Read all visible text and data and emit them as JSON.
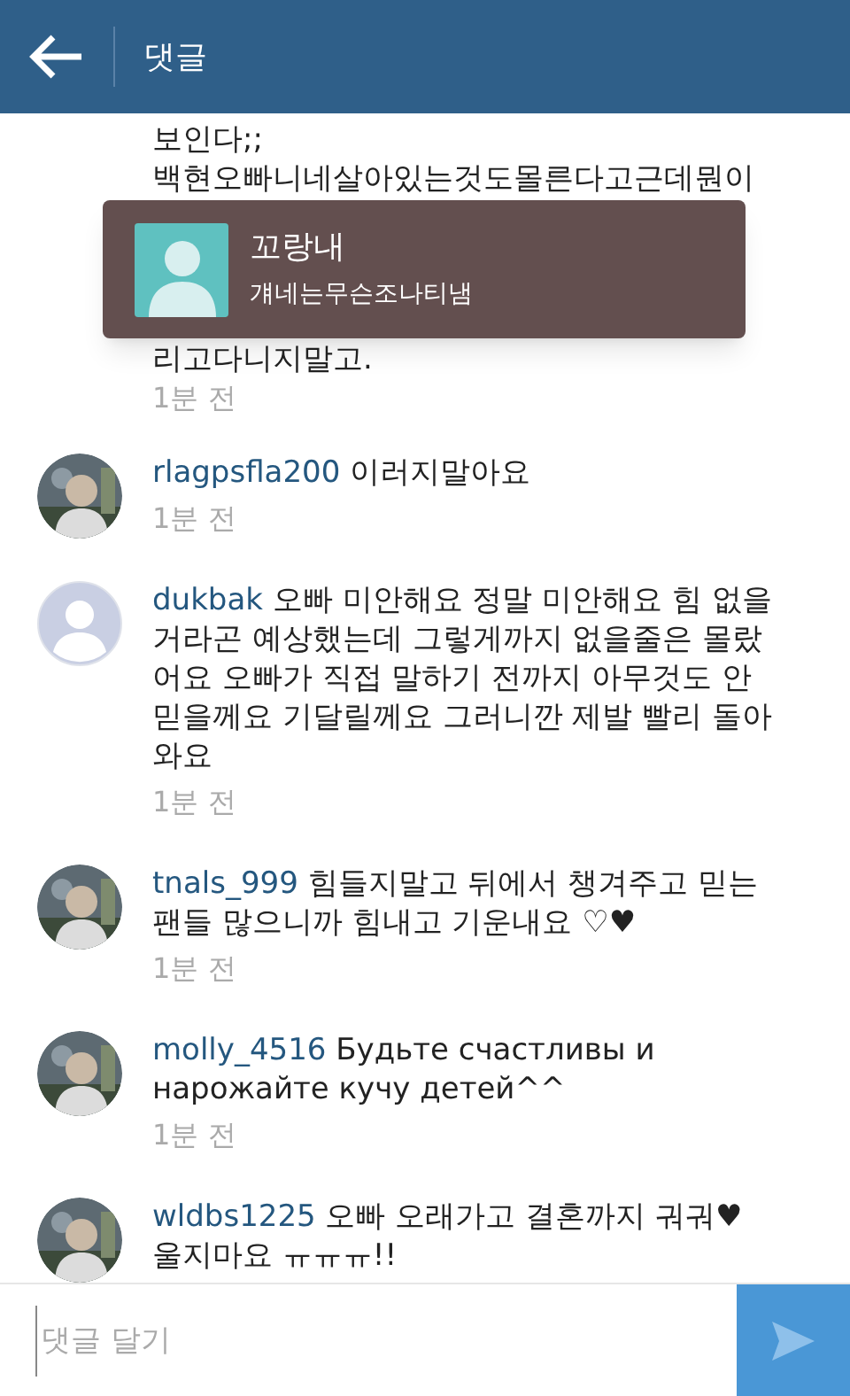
{
  "header": {
    "title": "댓글"
  },
  "comments": [
    {
      "kind": "partial",
      "lines": [
        "보인다;;",
        "백현오빠니네살아있는것도몰른다고근데뭔이"
      ],
      "lines_after": [
        "리고다니지말고."
      ],
      "time": "1분 전"
    },
    {
      "username": "rlagpsfla200",
      "text": "이러지말아요",
      "time": "1분 전"
    },
    {
      "kind": "default",
      "username": "dukbak",
      "text": "오빠 미안해요 정말 미안해요 힘 없을거라곤 예상했는데 그렇게까지 없을줄은 몰랐어요 오빠가 직접 말하기 전까지 아무것도 안믿을께요 기달릴께요 그러니깐 제발 빨리 돌아와요",
      "time": "1분 전"
    },
    {
      "username": "tnals_999",
      "text": "힘들지말고 뒤에서 챙겨주고 믿는 팬들 많으니까 힘내고 기운내요 ♡♥",
      "time": "1분 전"
    },
    {
      "username": "molly_4516",
      "text": "Будьте счастливы и нарожайте кучу детей^^",
      "time": "1분 전"
    },
    {
      "username": "wldbs1225",
      "text": "오빠 오래가고 결혼까지 궈궈♥ 울지마요 ㅠㅠㅠ!!"
    }
  ],
  "notification": {
    "title": "꼬랑내",
    "message": "걔네는무슨조나티냄"
  },
  "composer": {
    "placeholder": "댓글 달기"
  }
}
